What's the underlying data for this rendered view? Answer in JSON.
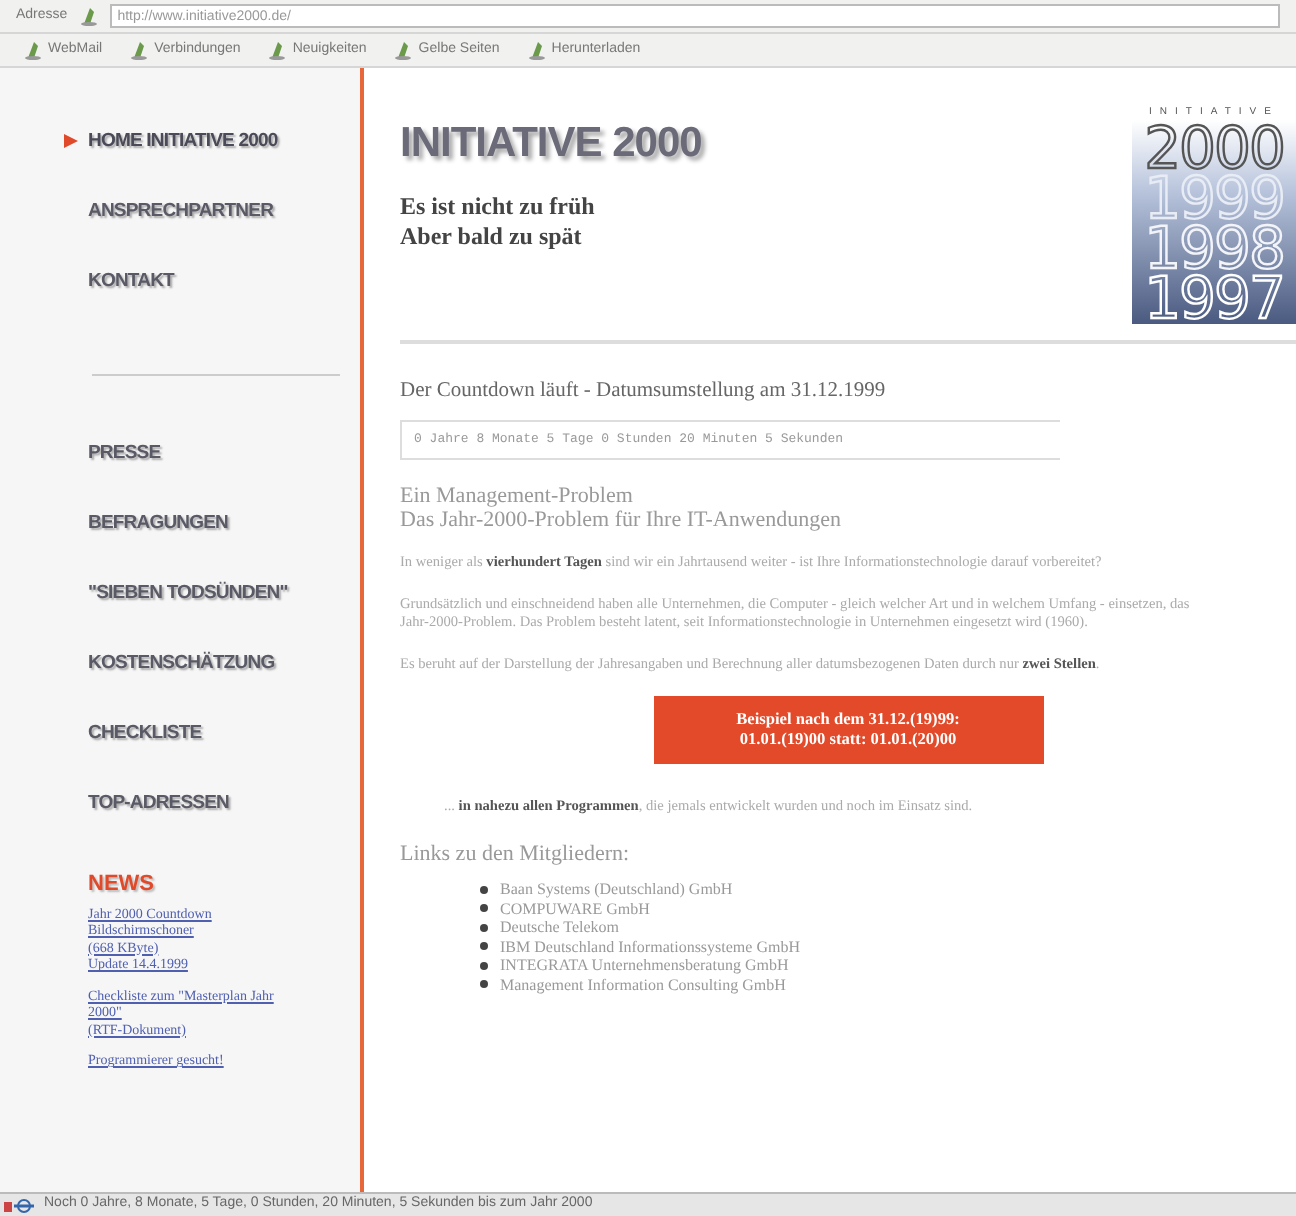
{
  "browser": {
    "address_label": "Adresse",
    "url": "http://www.initiative2000.de/",
    "links": [
      "WebMail",
      "Verbindungen",
      "Neuigkeiten",
      "Gelbe Seiten",
      "Herunterladen"
    ]
  },
  "sidebar": {
    "primary": [
      {
        "label": "HOME INITIATIVE 2000",
        "selected": true
      },
      {
        "label": "ANSPRECHPARTNER",
        "selected": false
      },
      {
        "label": "KONTAKT",
        "selected": false
      }
    ],
    "secondary": [
      {
        "label": "PRESSE",
        "selected": false
      },
      {
        "label": "BEFRAGUNGEN",
        "selected": false
      },
      {
        "label": "\"SIEBEN TODSÜNDEN\"",
        "selected": false
      },
      {
        "label": "KOSTENSCHÄTZUNG",
        "selected": false
      },
      {
        "label": "CHECKLISTE",
        "selected": false
      },
      {
        "label": "TOP-ADRESSEN",
        "selected": false
      }
    ],
    "news_heading": "NEWS",
    "news": [
      {
        "lines": [
          "Jahr 2000 Countdown",
          "Bildschirmschoner",
          "(668 KByte)",
          "Update 14.4.1999"
        ]
      },
      {
        "lines": [
          "Checkliste zum \"Masterplan Jahr",
          "2000\"",
          "(RTF-Dokument)"
        ]
      },
      {
        "lines": [
          "Programmierer gesucht!"
        ]
      }
    ]
  },
  "header": {
    "title": "INITIATIVE 2000",
    "tagline": [
      "Es ist nicht zu früh",
      "Aber bald zu spät"
    ],
    "logo": {
      "caption": "INITIATIVE",
      "years": [
        "2000",
        "1999",
        "1998",
        "1997"
      ]
    }
  },
  "countdown": {
    "heading": "Der Countdown läuft - Datumsumstellung am 31.12.1999",
    "display": "0 Jahre 8 Monate 5 Tage 0 Stunden 20 Minuten 5 Sekunden"
  },
  "article": {
    "heading": [
      "Ein Management-Problem",
      "Das Jahr-2000-Problem für Ihre IT-Anwendungen"
    ],
    "paragraphs": [
      "In weniger als **vierhundert Tagen** sind wir ein Jahrtausend weiter - ist Ihre Informationstechnologie darauf vorbereitet?",
      "Grundsätzlich und einschneidend haben alle Unternehmen, die Computer - gleich welcher Art und in welchem Umfang - einsetzen, das Jahr-2000-Problem. Das Problem besteht latent, seit Informationstechnologie in Unternehmen eingesetzt wird (1960).",
      "Es beruht auf der Darstellung der Jahresangaben und Berechnung aller datumsbezogenen Daten durch nur **zwei Stellen**."
    ],
    "example": [
      "Beispiel nach dem 31.12.(19)99:",
      "01.01.(19)00 statt: 01.01.(20)00"
    ],
    "closing": "... **in nahezu allen Programmen**, die jemals entwickelt wurden und noch im Einsatz sind.",
    "links_heading": "Links zu den Mitgliedern:",
    "members": [
      "Baan Systems (Deutschland) GmbH",
      "COMPUWARE GmbH",
      "Deutsche Telekom",
      "IBM Deutschland Informationssysteme GmbH",
      "INTEGRATA Unternehmensberatung GmbH",
      "Management Information Consulting GmbH"
    ]
  },
  "status_bar": {
    "text": "Noch 0 Jahre, 8 Monate, 5 Tage, 0 Stunden, 20 Minuten, 5 Sekunden bis zum Jahr 2000"
  }
}
